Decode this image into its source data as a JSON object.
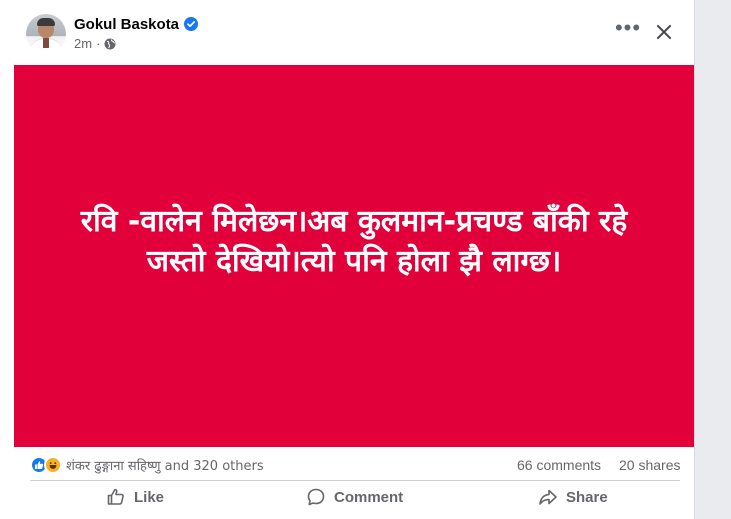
{
  "post": {
    "author": "Gokul Baskota",
    "timestamp": "2m",
    "text": "रवि -वालेन मिलेछन।अब कुलमान-प्रचण्ड बाँकी रहे जस्तो देखियो।त्यो पनि होला झै लाग्छ।",
    "background_color": "#e2003b",
    "icons": [
      "verified-badge-icon",
      "globe-icon",
      "more-options-icon",
      "close-icon"
    ]
  },
  "stats": {
    "reaction_names": "शंकर ढुङ्गाना सहिष्णु and 320 others",
    "comments": "66 comments",
    "shares": "20 shares",
    "reaction_icons": [
      "like-reaction-icon",
      "haha-reaction-icon"
    ]
  },
  "actions": {
    "like": "Like",
    "comment": "Comment",
    "share": "Share"
  }
}
